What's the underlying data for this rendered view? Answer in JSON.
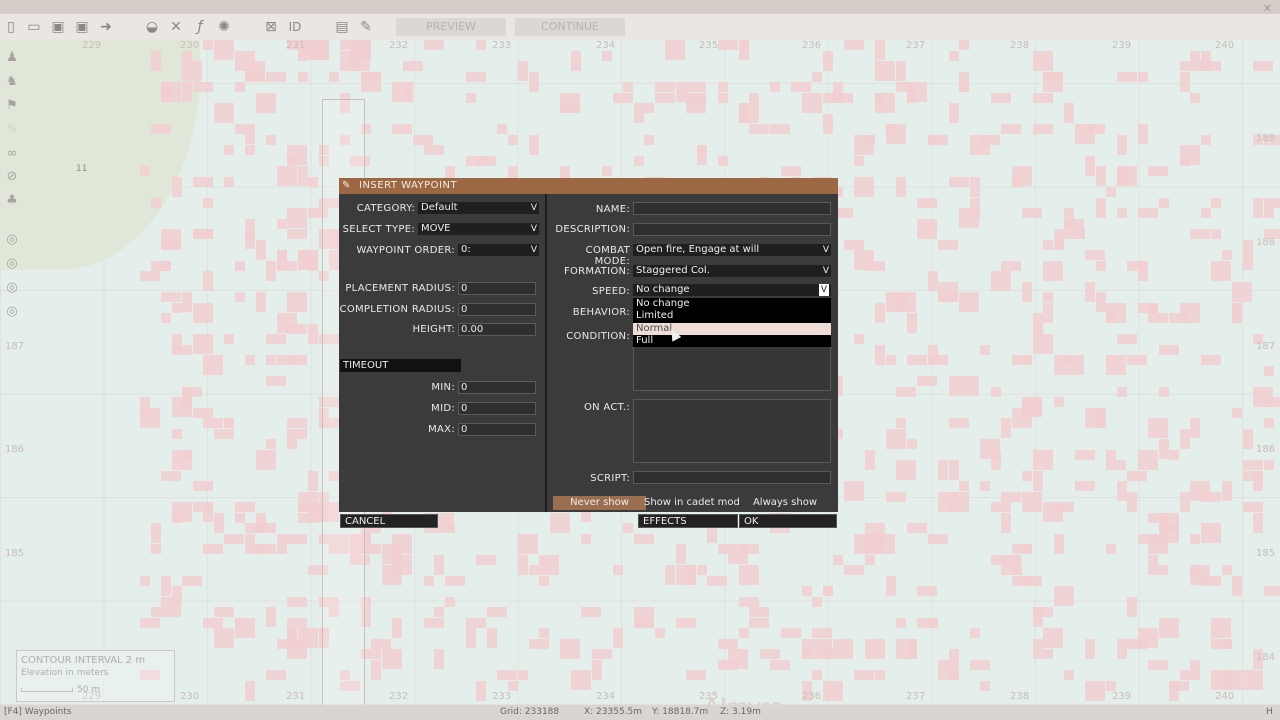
{
  "toolbar": {
    "preview_label": "PREVIEW",
    "continue_label": "CONTINUE",
    "icons": [
      "new-file-icon",
      "open-folder-icon",
      "save-icon",
      "save-as-icon",
      "export-icon",
      "vehicle-icon",
      "tools-icon",
      "function-icon",
      "settings-icon",
      "grid-icon",
      "id-icon",
      "layout-icon",
      "link-icon"
    ]
  },
  "sidebar": {
    "icons": [
      "unit-icon",
      "group-icon",
      "trigger-icon",
      "waypoint-icon",
      "synchronize-icon",
      "marker-icon",
      "module-icon",
      "radio-icon",
      "radio-icon-2",
      "radio-icon-3",
      "radio-icon-4"
    ]
  },
  "map": {
    "grid_top": [
      "229",
      "230",
      "231",
      "232",
      "233",
      "234",
      "235",
      "236",
      "237",
      "238",
      "239",
      "240"
    ],
    "grid_bottom": [
      "229",
      "230",
      "231",
      "232",
      "233",
      "234",
      "235",
      "236",
      "237",
      "238",
      "239",
      "240"
    ],
    "grid_right": [
      "189",
      "188",
      "187",
      "186",
      "185",
      "184"
    ],
    "grid_left": [
      "187",
      "186",
      "185"
    ],
    "town": "Almyra",
    "marker_num": "11"
  },
  "dialog": {
    "title": "INSERT WAYPOINT",
    "left": {
      "category_label": "CATEGORY:",
      "category_value": "Default",
      "select_type_label": "SELECT TYPE:",
      "select_type_value": "MOVE",
      "waypoint_order_label": "WAYPOINT ORDER:",
      "waypoint_order_value": "0:",
      "placement_radius_label": "PLACEMENT RADIUS:",
      "placement_radius_value": "0",
      "completion_radius_label": "COMPLETION RADIUS:",
      "completion_radius_value": "0",
      "height_label": "HEIGHT:",
      "height_value": "0.00",
      "timeout_label": "TIMEOUT",
      "min_label": "MIN:",
      "min_value": "0",
      "mid_label": "MID:",
      "mid_value": "0",
      "max_label": "MAX:",
      "max_value": "0"
    },
    "right": {
      "name_label": "NAME:",
      "name_value": "",
      "description_label": "DESCRIPTION:",
      "description_value": "",
      "combat_mode_label": "COMBAT MODE:",
      "combat_mode_value": "Open fire, Engage at will",
      "formation_label": "FORMATION:",
      "formation_value": "Staggered Col.",
      "speed_label": "SPEED:",
      "speed_value": "No change",
      "speed_options": [
        "No change",
        "Limited",
        "Normal",
        "Full"
      ],
      "speed_highlighted": "Normal",
      "behavior_label": "BEHAVIOR:",
      "condition_label": "CONDITION:",
      "on_act_label": "ON ACT.:",
      "script_label": "SCRIPT:",
      "script_value": ""
    },
    "show_options": [
      "Never show",
      "Show in cadet mode",
      "Always show"
    ],
    "show_selected": "Never show",
    "buttons": {
      "cancel": "CANCEL",
      "effects": "EFFECTS",
      "ok": "OK"
    },
    "dropdown_arrow": "V"
  },
  "legend": {
    "contour": "CONTOUR INTERVAL  2 m",
    "elevation": "Elevation in meters",
    "scale": "50 m"
  },
  "statusbar": {
    "mode": "[F4]  Waypoints",
    "grid": "Grid: 233188",
    "x": "X: 23355.5m",
    "y": "Y: 18818.7m",
    "z": "Z: 3.19m",
    "right": "H"
  },
  "colors": {
    "title_bar": "#9c6844",
    "dialog_bg": "#3b3b3b",
    "highlight": "#f0dcd6",
    "map_cells": "#f3cdd0"
  }
}
